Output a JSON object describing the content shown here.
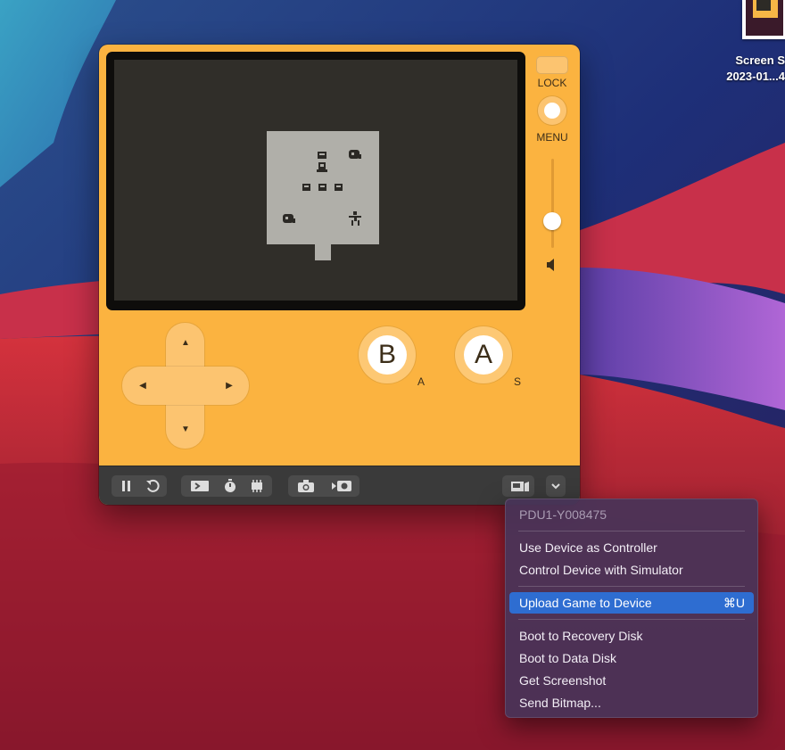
{
  "desktop": {
    "file_label_line1": "Screen S",
    "file_label_line2": "2023-01...4"
  },
  "simulator": {
    "lock_label": "LOCK",
    "menu_label": "MENU",
    "b_button_label": "B",
    "a_button_label": "A",
    "b_key_hint": "A",
    "a_key_hint": "S",
    "dpad_arrows": {
      "up": "▲",
      "down": "▼",
      "left": "◀",
      "right": "▶"
    },
    "volume_level": 0.3
  },
  "colors": {
    "device_body": "#fbb340",
    "screen": "#302e29",
    "game_area": "#b0afa9",
    "menu_highlight": "#2e6dd1"
  },
  "toolbar": {
    "buttons": [
      "pause-icon",
      "restart-icon",
      "console-icon",
      "stopwatch-icon",
      "memory-icon",
      "camera-icon",
      "record-icon",
      "device-icon",
      "chevron-down-icon"
    ]
  },
  "device_menu": {
    "device_name": "PDU1-Y008475",
    "items": [
      {
        "label": "Use Device as Controller",
        "shortcut": ""
      },
      {
        "label": "Control Device with Simulator",
        "shortcut": ""
      },
      {
        "label": "Upload Game to Device",
        "shortcut": "⌘U"
      },
      {
        "label": "Boot to Recovery Disk",
        "shortcut": ""
      },
      {
        "label": "Boot to Data Disk",
        "shortcut": ""
      },
      {
        "label": "Get Screenshot",
        "shortcut": ""
      },
      {
        "label": "Send Bitmap...",
        "shortcut": ""
      }
    ]
  }
}
